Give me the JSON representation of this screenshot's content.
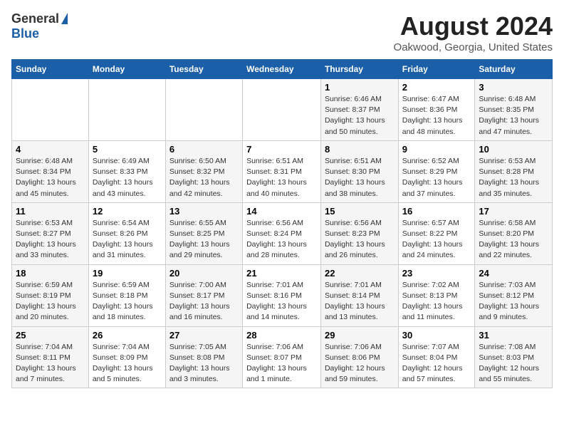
{
  "header": {
    "logo_general": "General",
    "logo_blue": "Blue",
    "title": "August 2024",
    "subtitle": "Oakwood, Georgia, United States"
  },
  "days_of_week": [
    "Sunday",
    "Monday",
    "Tuesday",
    "Wednesday",
    "Thursday",
    "Friday",
    "Saturday"
  ],
  "weeks": [
    [
      {
        "day": "",
        "info": ""
      },
      {
        "day": "",
        "info": ""
      },
      {
        "day": "",
        "info": ""
      },
      {
        "day": "",
        "info": ""
      },
      {
        "day": "1",
        "info": "Sunrise: 6:46 AM\nSunset: 8:37 PM\nDaylight: 13 hours\nand 50 minutes."
      },
      {
        "day": "2",
        "info": "Sunrise: 6:47 AM\nSunset: 8:36 PM\nDaylight: 13 hours\nand 48 minutes."
      },
      {
        "day": "3",
        "info": "Sunrise: 6:48 AM\nSunset: 8:35 PM\nDaylight: 13 hours\nand 47 minutes."
      }
    ],
    [
      {
        "day": "4",
        "info": "Sunrise: 6:48 AM\nSunset: 8:34 PM\nDaylight: 13 hours\nand 45 minutes."
      },
      {
        "day": "5",
        "info": "Sunrise: 6:49 AM\nSunset: 8:33 PM\nDaylight: 13 hours\nand 43 minutes."
      },
      {
        "day": "6",
        "info": "Sunrise: 6:50 AM\nSunset: 8:32 PM\nDaylight: 13 hours\nand 42 minutes."
      },
      {
        "day": "7",
        "info": "Sunrise: 6:51 AM\nSunset: 8:31 PM\nDaylight: 13 hours\nand 40 minutes."
      },
      {
        "day": "8",
        "info": "Sunrise: 6:51 AM\nSunset: 8:30 PM\nDaylight: 13 hours\nand 38 minutes."
      },
      {
        "day": "9",
        "info": "Sunrise: 6:52 AM\nSunset: 8:29 PM\nDaylight: 13 hours\nand 37 minutes."
      },
      {
        "day": "10",
        "info": "Sunrise: 6:53 AM\nSunset: 8:28 PM\nDaylight: 13 hours\nand 35 minutes."
      }
    ],
    [
      {
        "day": "11",
        "info": "Sunrise: 6:53 AM\nSunset: 8:27 PM\nDaylight: 13 hours\nand 33 minutes."
      },
      {
        "day": "12",
        "info": "Sunrise: 6:54 AM\nSunset: 8:26 PM\nDaylight: 13 hours\nand 31 minutes."
      },
      {
        "day": "13",
        "info": "Sunrise: 6:55 AM\nSunset: 8:25 PM\nDaylight: 13 hours\nand 29 minutes."
      },
      {
        "day": "14",
        "info": "Sunrise: 6:56 AM\nSunset: 8:24 PM\nDaylight: 13 hours\nand 28 minutes."
      },
      {
        "day": "15",
        "info": "Sunrise: 6:56 AM\nSunset: 8:23 PM\nDaylight: 13 hours\nand 26 minutes."
      },
      {
        "day": "16",
        "info": "Sunrise: 6:57 AM\nSunset: 8:22 PM\nDaylight: 13 hours\nand 24 minutes."
      },
      {
        "day": "17",
        "info": "Sunrise: 6:58 AM\nSunset: 8:20 PM\nDaylight: 13 hours\nand 22 minutes."
      }
    ],
    [
      {
        "day": "18",
        "info": "Sunrise: 6:59 AM\nSunset: 8:19 PM\nDaylight: 13 hours\nand 20 minutes."
      },
      {
        "day": "19",
        "info": "Sunrise: 6:59 AM\nSunset: 8:18 PM\nDaylight: 13 hours\nand 18 minutes."
      },
      {
        "day": "20",
        "info": "Sunrise: 7:00 AM\nSunset: 8:17 PM\nDaylight: 13 hours\nand 16 minutes."
      },
      {
        "day": "21",
        "info": "Sunrise: 7:01 AM\nSunset: 8:16 PM\nDaylight: 13 hours\nand 14 minutes."
      },
      {
        "day": "22",
        "info": "Sunrise: 7:01 AM\nSunset: 8:14 PM\nDaylight: 13 hours\nand 13 minutes."
      },
      {
        "day": "23",
        "info": "Sunrise: 7:02 AM\nSunset: 8:13 PM\nDaylight: 13 hours\nand 11 minutes."
      },
      {
        "day": "24",
        "info": "Sunrise: 7:03 AM\nSunset: 8:12 PM\nDaylight: 13 hours\nand 9 minutes."
      }
    ],
    [
      {
        "day": "25",
        "info": "Sunrise: 7:04 AM\nSunset: 8:11 PM\nDaylight: 13 hours\nand 7 minutes."
      },
      {
        "day": "26",
        "info": "Sunrise: 7:04 AM\nSunset: 8:09 PM\nDaylight: 13 hours\nand 5 minutes."
      },
      {
        "day": "27",
        "info": "Sunrise: 7:05 AM\nSunset: 8:08 PM\nDaylight: 13 hours\nand 3 minutes."
      },
      {
        "day": "28",
        "info": "Sunrise: 7:06 AM\nSunset: 8:07 PM\nDaylight: 13 hours\nand 1 minute."
      },
      {
        "day": "29",
        "info": "Sunrise: 7:06 AM\nSunset: 8:06 PM\nDaylight: 12 hours\nand 59 minutes."
      },
      {
        "day": "30",
        "info": "Sunrise: 7:07 AM\nSunset: 8:04 PM\nDaylight: 12 hours\nand 57 minutes."
      },
      {
        "day": "31",
        "info": "Sunrise: 7:08 AM\nSunset: 8:03 PM\nDaylight: 12 hours\nand 55 minutes."
      }
    ]
  ]
}
